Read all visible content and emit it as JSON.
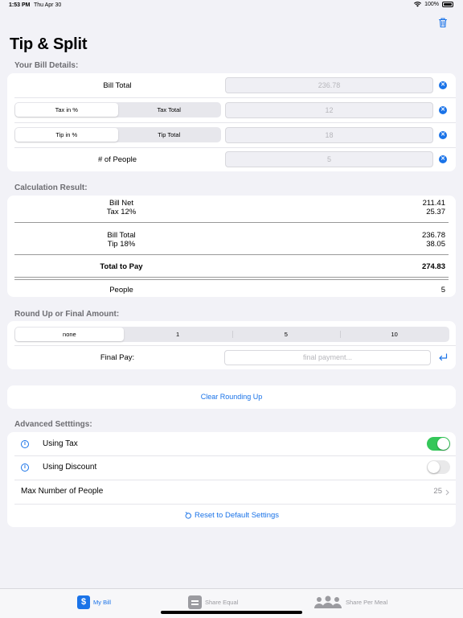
{
  "status_bar": {
    "time": "1:53 PM",
    "date": "Thu Apr 30",
    "battery": "100%"
  },
  "title": "Tip & Split",
  "bill_details": {
    "header": "Your Bill Details:",
    "bill_total_label": "Bill Total",
    "bill_total_placeholder": "236.78",
    "tax_segments": [
      "Tax in %",
      "Tax Total"
    ],
    "tax_placeholder": "12",
    "tip_segments": [
      "Tip in %",
      "Tip Total"
    ],
    "tip_placeholder": "18",
    "people_label": "# of People",
    "people_placeholder": "5"
  },
  "calculation": {
    "header": "Calculation Result:",
    "bill_net_label": "Bill Net",
    "bill_net_value": "211.41",
    "tax_label": "Tax 12%",
    "tax_value": "25.37",
    "bill_total_label": "Bill Total",
    "bill_total_value": "236.78",
    "tip_label": "Tip 18%",
    "tip_value": "38.05",
    "total_label": "Total to Pay",
    "total_value": "274.83",
    "people_label": "People",
    "people_value": "5"
  },
  "rounding": {
    "header": "Round Up or Final Amount:",
    "options": [
      "none",
      "1",
      "5",
      "10"
    ],
    "final_pay_label": "Final Pay:",
    "final_pay_placeholder": "final payment..."
  },
  "clear_rounding_label": "Clear Rounding Up",
  "advanced": {
    "header": "Advanced Setttings:",
    "using_tax_label": "Using Tax",
    "using_tax_on": true,
    "using_discount_label": "Using Discount",
    "using_discount_on": false,
    "max_people_label": "Max Number of People",
    "max_people_value": "25",
    "reset_label": "Reset to Default Settings"
  },
  "tabs": [
    {
      "label": "My Bill",
      "icon": "dollar-icon",
      "active": true
    },
    {
      "label": "Share Equal",
      "icon": "equal-icon",
      "active": false
    },
    {
      "label": "Share Per Meal",
      "icon": "people-icon",
      "active": false
    }
  ],
  "colors": {
    "accent": "#1a73e8",
    "toggle_on": "#34c759",
    "background": "#f2f2f7"
  }
}
